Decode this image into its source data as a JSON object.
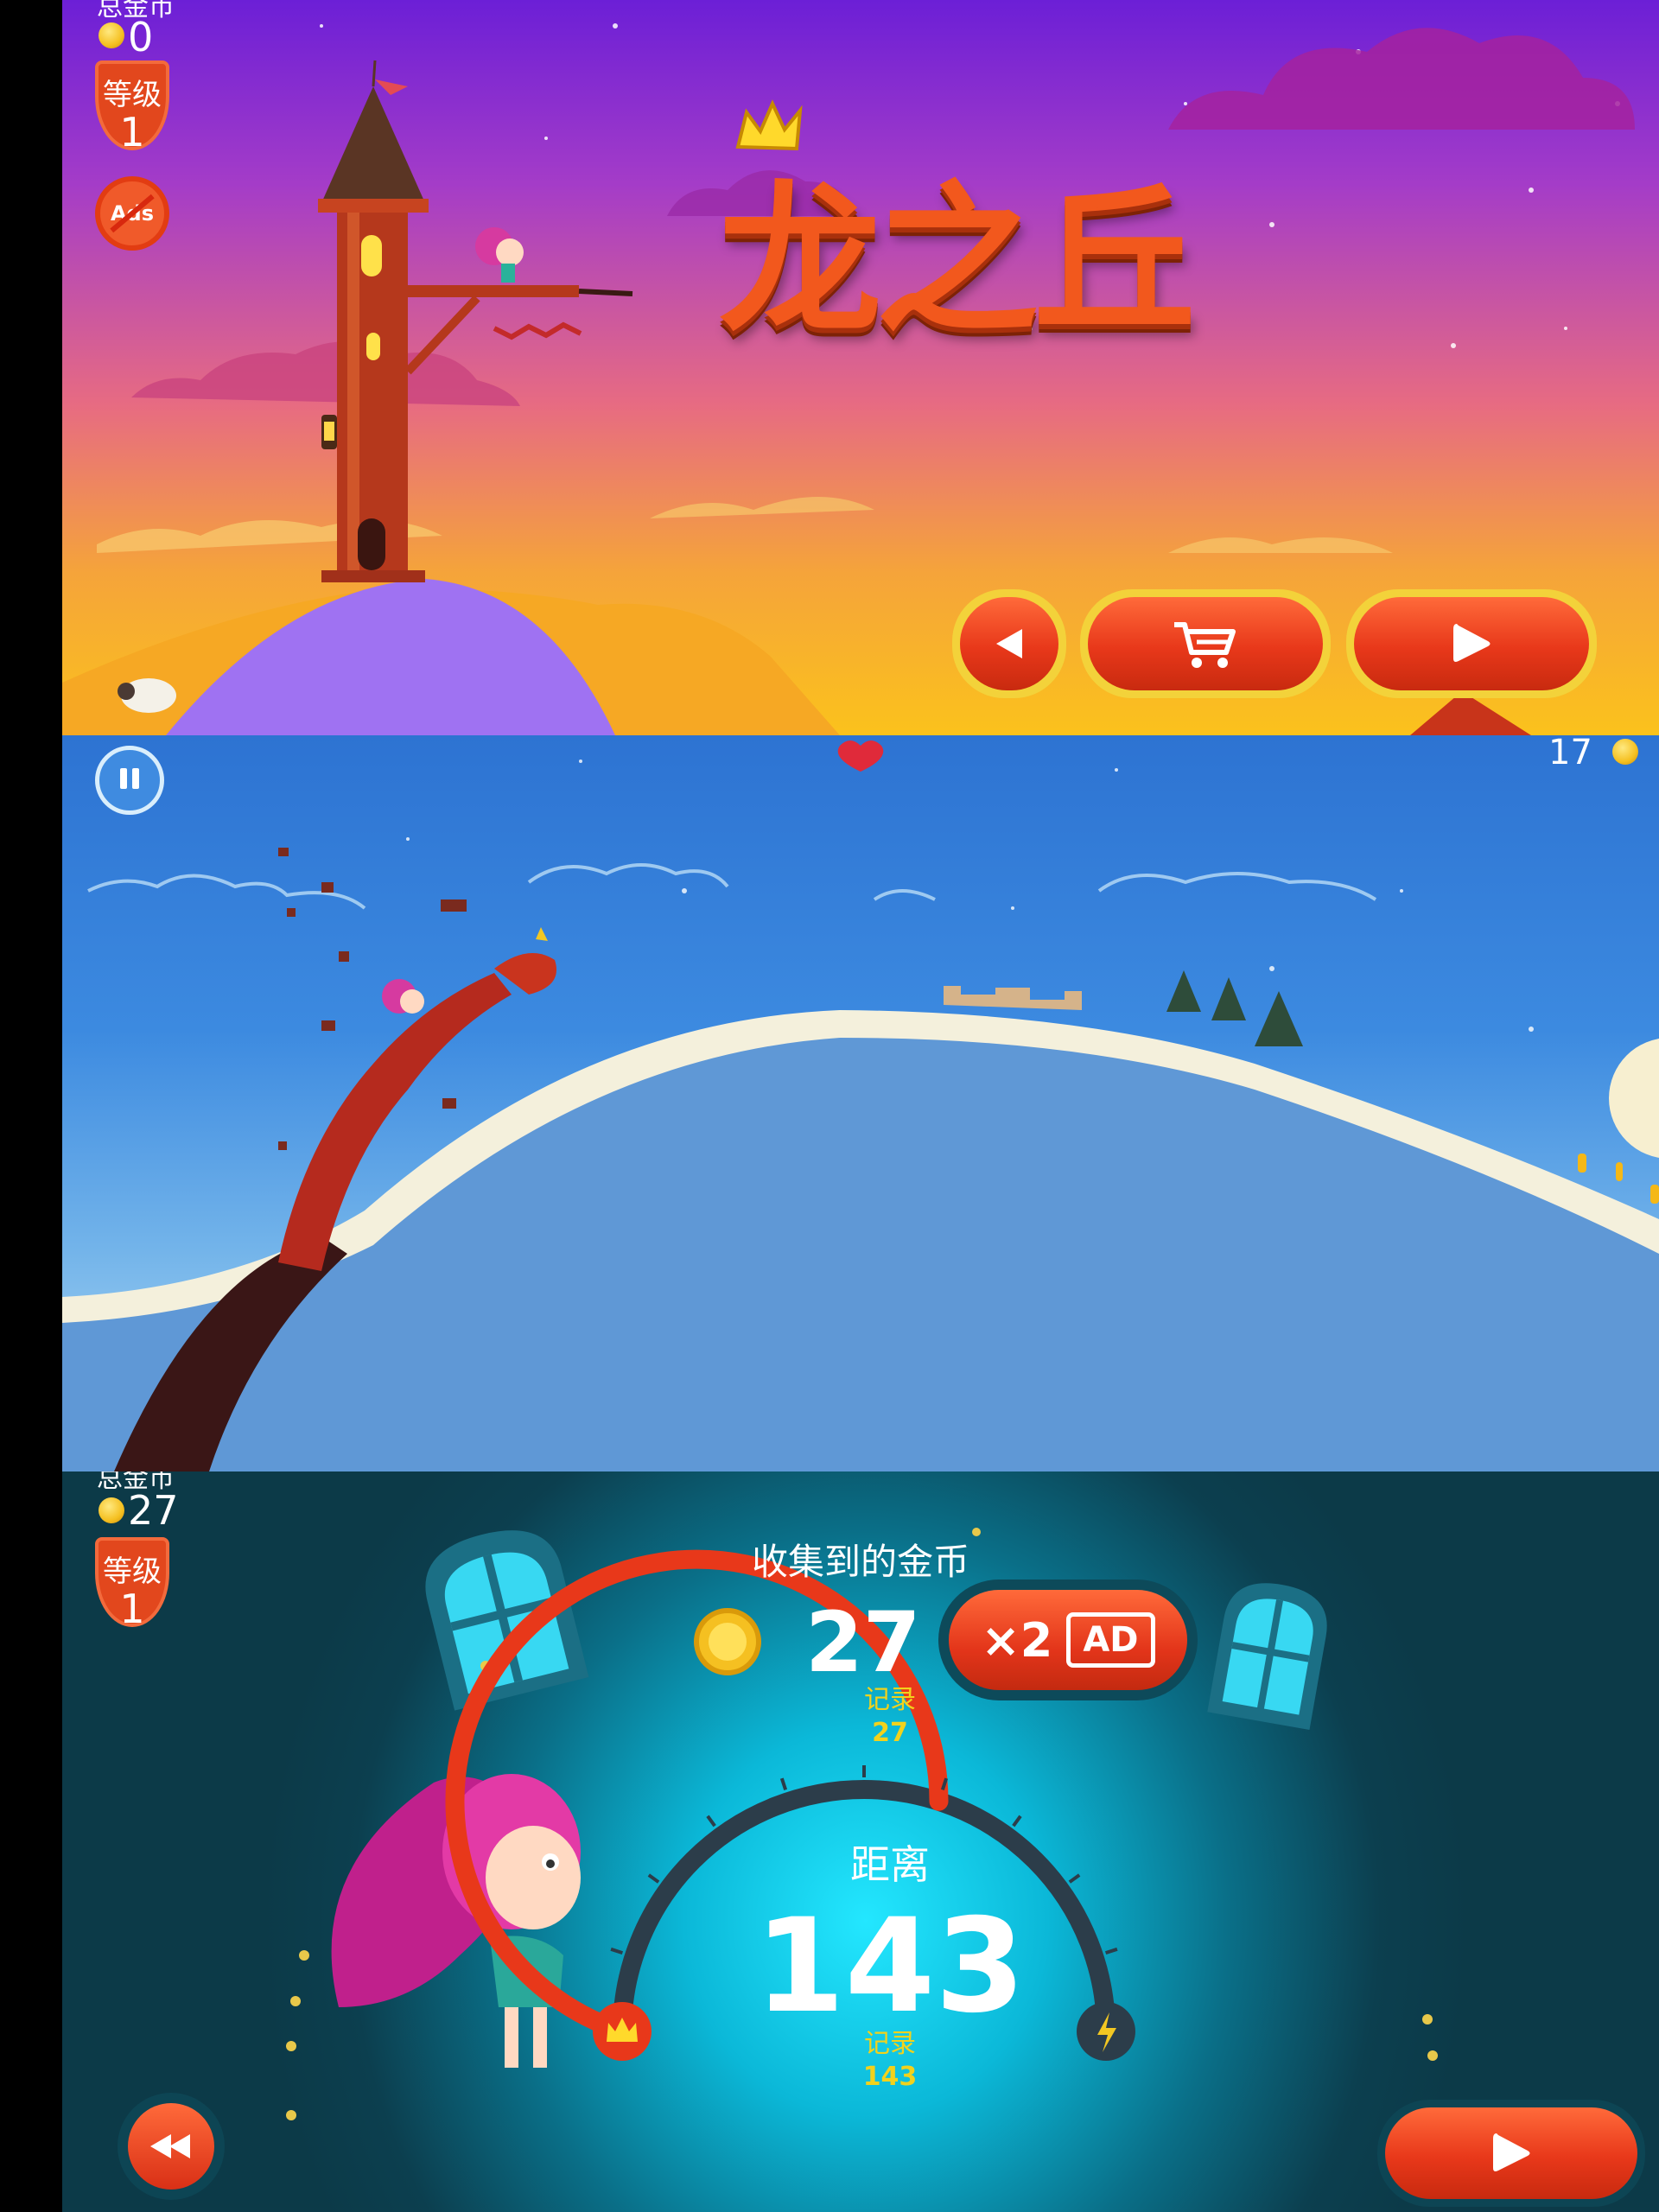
{
  "menu_screen": {
    "total_coins_label": "总金币",
    "total_coins_value": "0",
    "level_label": "等级",
    "level_value": "1",
    "no_ads_label": "Ads",
    "game_title": "龙之丘",
    "buttons": {
      "back": "back-icon",
      "shop": "cart-icon",
      "play": "play-icon"
    }
  },
  "gameplay_screen": {
    "coin_count": "17",
    "pause_icon": "pause-icon",
    "life_icon": "heart-icon"
  },
  "results_screen": {
    "total_coins_label": "总金币",
    "total_coins_value": "27",
    "level_label": "等级",
    "level_value": "1",
    "coins_collected_label": "收集到的金币",
    "coins_collected_value": "27",
    "coins_record_label": "记录",
    "coins_record_value": "27",
    "double_multiplier": "×2",
    "double_ad_label": "AD",
    "distance_label": "距离",
    "distance_value": "143",
    "distance_record_label": "记录",
    "distance_record_value": "143",
    "gauge_fill_fraction": 0.6,
    "gauge_left_icon": "crown-icon",
    "gauge_right_icon": "lightning-icon",
    "buttons": {
      "rewind": "rewind-icon",
      "play": "play-icon"
    }
  },
  "colors": {
    "accent_orange": "#e8381a",
    "button_rim_yellow": "#f3d23a",
    "record_yellow": "#f2d21c"
  }
}
